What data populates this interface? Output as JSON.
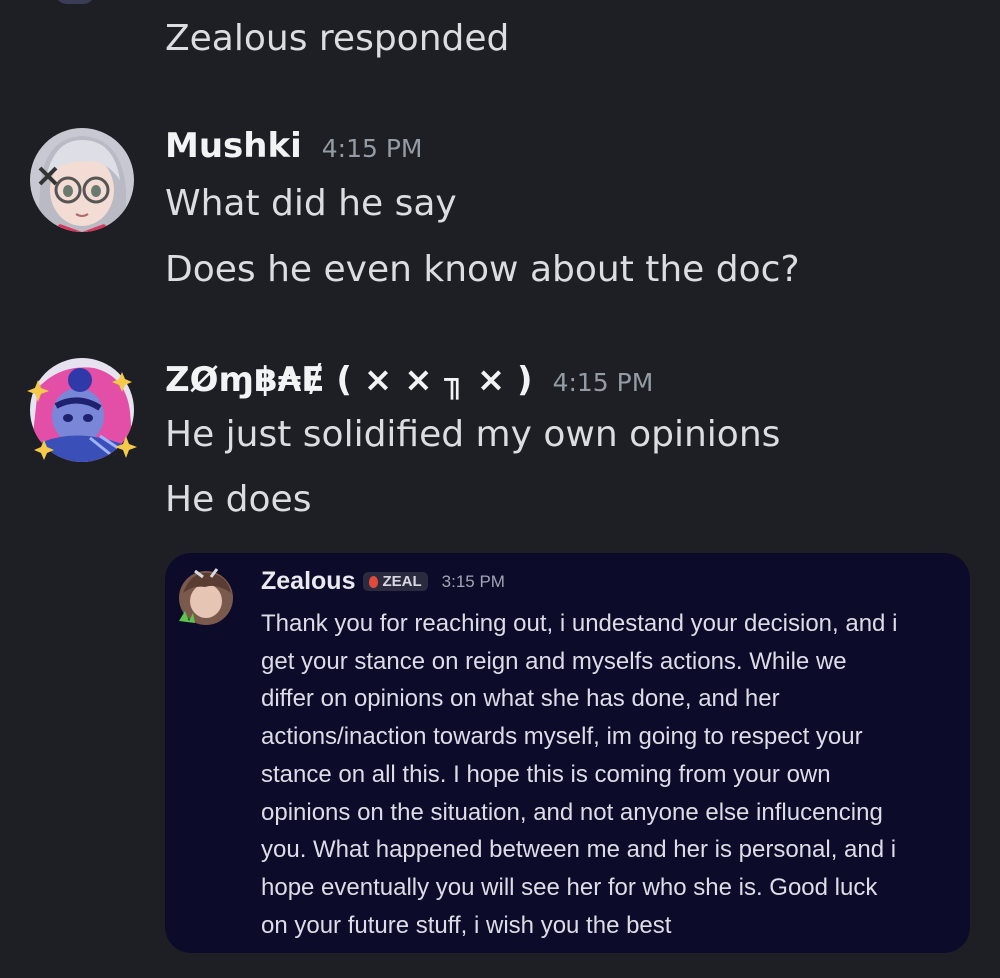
{
  "messages": {
    "prior_line": "Zealous responded",
    "mushki": {
      "username": "Mushki",
      "timestamp": "4:15 PM",
      "lines": [
        "What did he say",
        "Does he even know about the doc?"
      ]
    },
    "zombae": {
      "username": "ZØɱ฿₳Ɇ ( ⨯ × ╖ × )",
      "timestamp": "4:15 PM",
      "lines": [
        "He just solidified my own opinions",
        "He does"
      ]
    }
  },
  "embed": {
    "username": "Zealous",
    "tag": "ZEAL",
    "timestamp": "3:15 PM",
    "lines": [
      "Thank you for reaching out, i undestand your decision, and i",
      "get your stance on reign and myselfs actions. While we",
      "differ on opinions on what she has done, and her",
      "actions/inaction towards myself, im going to respect your",
      "stance on all this. I hope this is coming from your own",
      "opinions on the situation, and not anyone else influcencing",
      "you. What happened between me and her is personal, and i",
      "hope eventually you will see her for who she is. Good luck",
      "on your future stuff, i wish you the best"
    ]
  },
  "colors": {
    "background": "#1e1f24",
    "text": "#dbdee1",
    "timestamp": "#949ba4",
    "embed_background": "#0c0c2a"
  },
  "icons": [
    "avatar-mushki",
    "avatar-zombae",
    "avatar-zealous",
    "flame-icon"
  ]
}
